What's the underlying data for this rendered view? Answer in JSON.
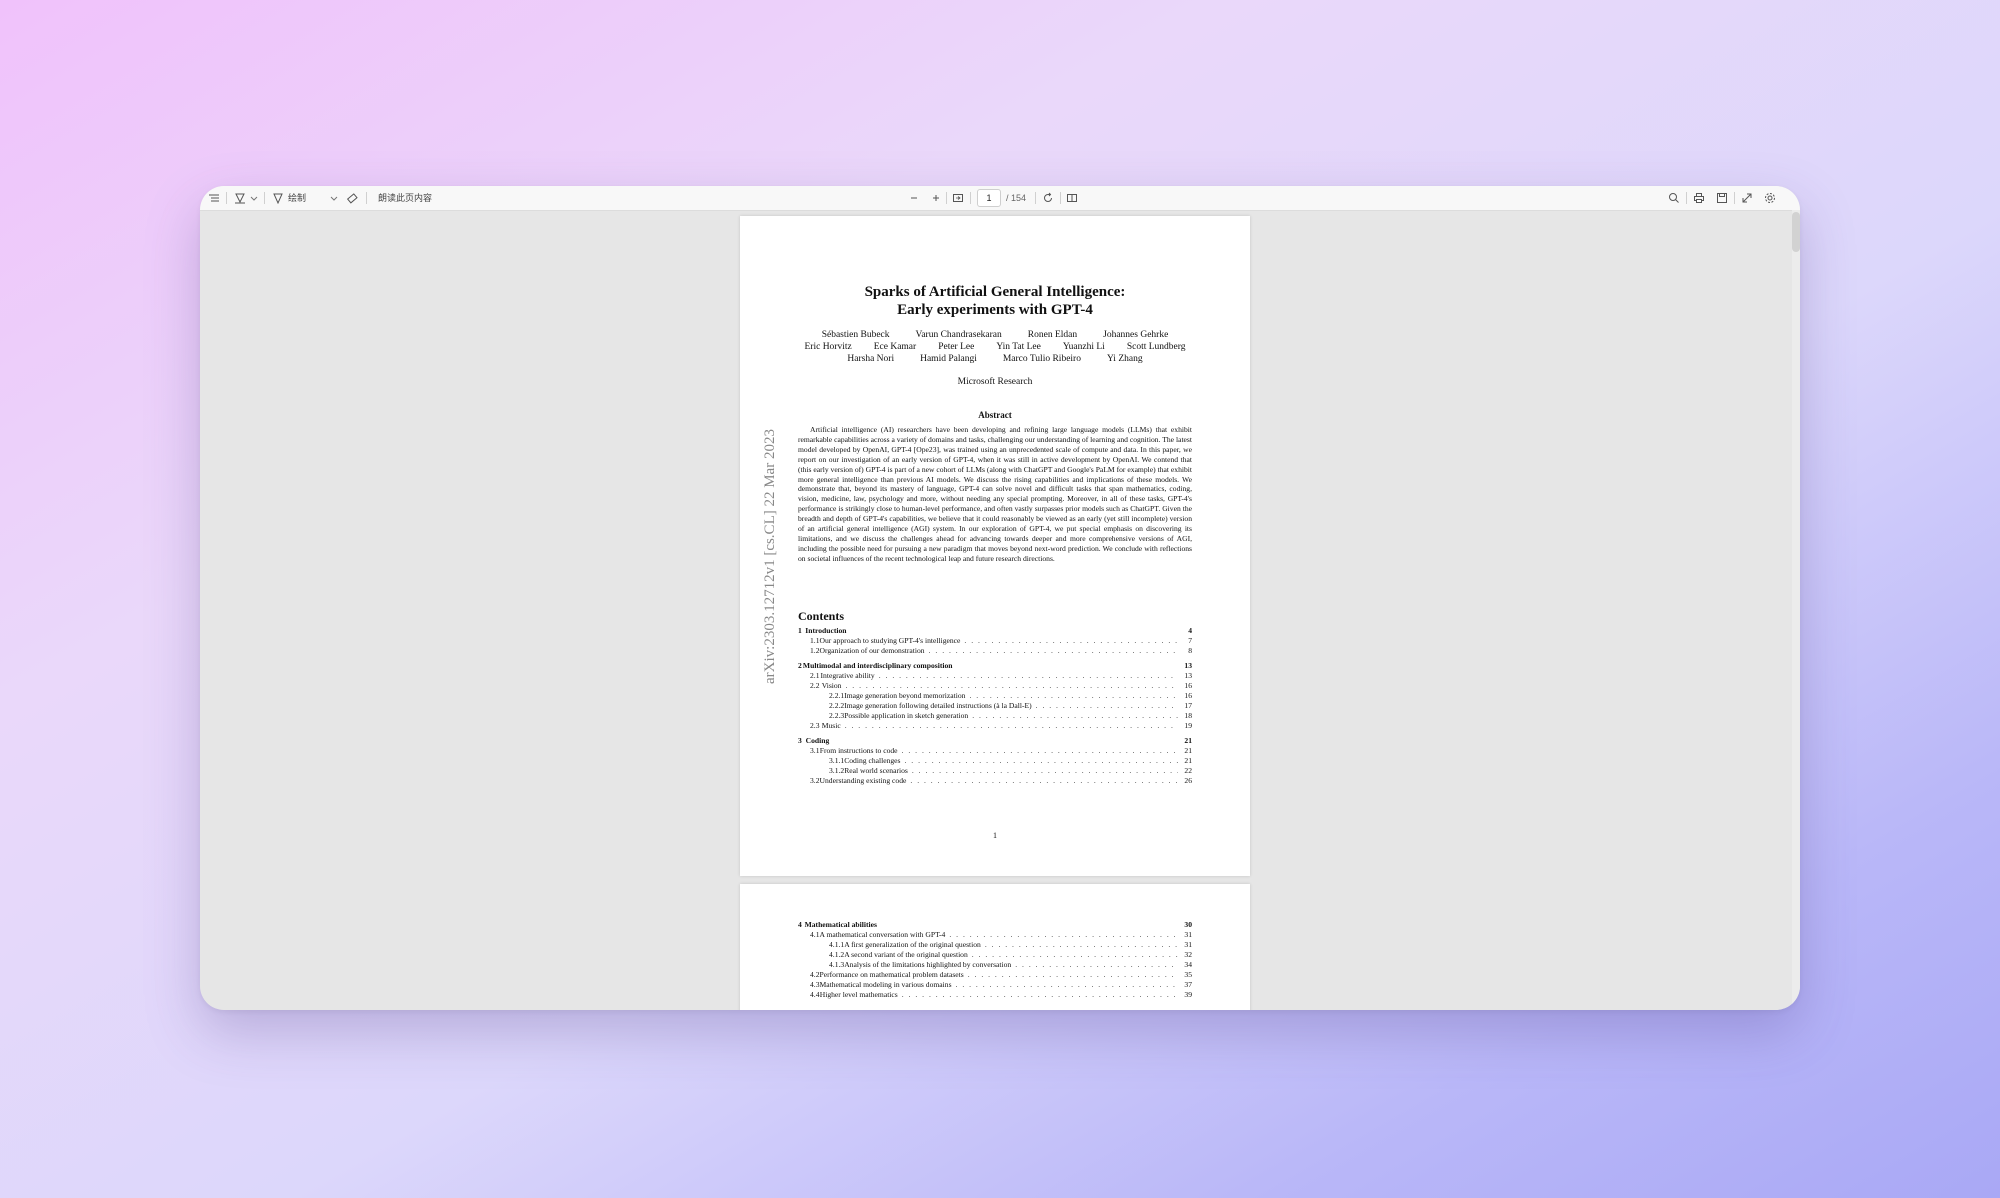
{
  "toolbar": {
    "draw_label": "绘制",
    "read_aloud_label": "朗读此页内容",
    "page_current": "1",
    "page_total": "/ 154"
  },
  "page1": {
    "title_line1": "Sparks of Artificial General Intelligence:",
    "title_line2": "Early experiments with GPT-4",
    "authors": [
      [
        "Sébastien Bubeck",
        "Varun Chandrasekaran",
        "Ronen Eldan",
        "Johannes Gehrke"
      ],
      [
        "Eric Horvitz",
        "Ece Kamar",
        "Peter Lee",
        "Yin Tat Lee",
        "Yuanzhi Li",
        "Scott Lundberg"
      ],
      [
        "Harsha Nori",
        "Hamid Palangi",
        "Marco Tulio Ribeiro",
        "Yi Zhang"
      ]
    ],
    "affiliation": "Microsoft Research",
    "abstract_heading": "Abstract",
    "abstract": "Artificial intelligence (AI) researchers have been developing and refining large language models (LLMs) that exhibit remarkable capabilities across a variety of domains and tasks, challenging our understanding of learning and cognition. The latest model developed by OpenAI, GPT-4 [Ope23], was trained using an unprecedented scale of compute and data. In this paper, we report on our investigation of an early version of GPT-4, when it was still in active development by OpenAI. We contend that (this early version of) GPT-4 is part of a new cohort of LLMs (along with ChatGPT and Google's PaLM for example) that exhibit more general intelligence than previous AI models. We discuss the rising capabilities and implications of these models. We demonstrate that, beyond its mastery of language, GPT-4 can solve novel and difficult tasks that span mathematics, coding, vision, medicine, law, psychology and more, without needing any special prompting. Moreover, in all of these tasks, GPT-4's performance is strikingly close to human-level performance, and often vastly surpasses prior models such as ChatGPT. Given the breadth and depth of GPT-4's capabilities, we believe that it could reasonably be viewed as an early (yet still incomplete) version of an artificial general intelligence (AGI) system. In our exploration of GPT-4, we put special emphasis on discovering its limitations, and we discuss the challenges ahead for advancing towards deeper and more comprehensive versions of AGI, including the possible need for pursuing a new paradigm that moves beyond next-word prediction. We conclude with reflections on societal influences of the recent technological leap and future research directions.",
    "arxiv_stamp": "arXiv:2303.12712v1  [cs.CL]  22 Mar 2023",
    "contents_heading": "Contents",
    "toc": [
      {
        "num": "1",
        "label": "Introduction",
        "page": "4",
        "level": 0
      },
      {
        "num": "1.1",
        "label": "Our approach to studying GPT-4's intelligence",
        "page": "7",
        "level": 1
      },
      {
        "num": "1.2",
        "label": "Organization of our demonstration",
        "page": "8",
        "level": 1
      },
      {
        "num": "2",
        "label": "Multimodal and interdisciplinary composition",
        "page": "13",
        "level": 0
      },
      {
        "num": "2.1",
        "label": "Integrative ability",
        "page": "13",
        "level": 1
      },
      {
        "num": "2.2",
        "label": "Vision",
        "page": "16",
        "level": 1
      },
      {
        "num": "2.2.1",
        "label": "Image generation beyond memorization",
        "page": "16",
        "level": 2
      },
      {
        "num": "2.2.2",
        "label": "Image generation following detailed instructions (à la Dall-E)",
        "page": "17",
        "level": 2
      },
      {
        "num": "2.2.3",
        "label": "Possible application in sketch generation",
        "page": "18",
        "level": 2
      },
      {
        "num": "2.3",
        "label": "Music",
        "page": "19",
        "level": 1
      },
      {
        "num": "3",
        "label": "Coding",
        "page": "21",
        "level": 0
      },
      {
        "num": "3.1",
        "label": "From instructions to code",
        "page": "21",
        "level": 1
      },
      {
        "num": "3.1.1",
        "label": "Coding challenges",
        "page": "21",
        "level": 2
      },
      {
        "num": "3.1.2",
        "label": "Real world scenarios",
        "page": "22",
        "level": 2
      },
      {
        "num": "3.2",
        "label": "Understanding existing code",
        "page": "26",
        "level": 1
      }
    ],
    "page_number": "1"
  },
  "page2": {
    "toc": [
      {
        "num": "4",
        "label": "Mathematical abilities",
        "page": "30",
        "level": 0
      },
      {
        "num": "4.1",
        "label": "A mathematical conversation with GPT-4",
        "page": "31",
        "level": 1
      },
      {
        "num": "4.1.1",
        "label": "A first generalization of the original question",
        "page": "31",
        "level": 2
      },
      {
        "num": "4.1.2",
        "label": "A second variant of the original question",
        "page": "32",
        "level": 2
      },
      {
        "num": "4.1.3",
        "label": "Analysis of the limitations highlighted by conversation",
        "page": "34",
        "level": 2
      },
      {
        "num": "4.2",
        "label": "Performance on mathematical problem datasets",
        "page": "35",
        "level": 1
      },
      {
        "num": "4.3",
        "label": "Mathematical modeling in various domains",
        "page": "37",
        "level": 1
      },
      {
        "num": "4.4",
        "label": "Higher level mathematics",
        "page": "39",
        "level": 1
      }
    ]
  }
}
